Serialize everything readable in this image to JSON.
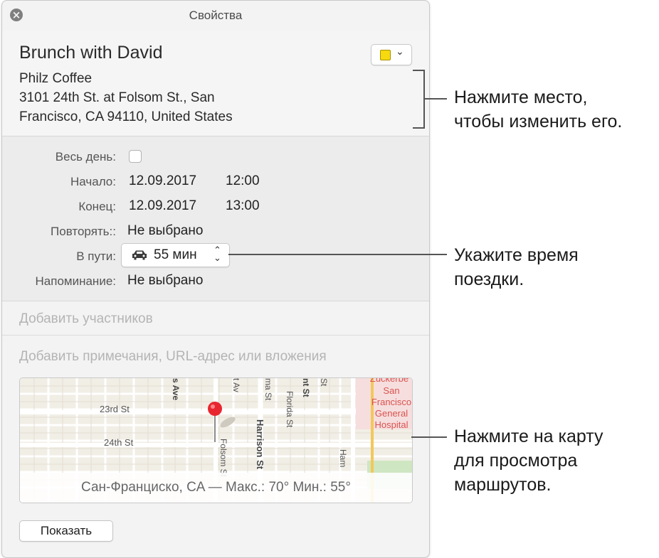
{
  "window": {
    "title": "Свойства"
  },
  "event": {
    "title": "Brunch with David",
    "color": "#f6d90f",
    "location": [
      "Philz Coffee",
      "3101 24th St. at Folsom St., San",
      "Francisco, CA 94110, United States"
    ]
  },
  "details": {
    "all_day_label": "Весь день:",
    "all_day_checked": false,
    "start_label": "Начало:",
    "start_date": "12.09.2017",
    "start_time": "12:00",
    "end_label": "Конец:",
    "end_date": "12.09.2017",
    "end_time": "13:00",
    "repeat_label": "Повторять::",
    "repeat_value": "Не выбрано",
    "travel_label": "В пути:",
    "travel_value": "55 мин",
    "alert_label": "Напоминание:",
    "alert_value": "Не выбрано"
  },
  "invitees_placeholder": "Добавить участников",
  "notes_placeholder": "Добавить примечания, URL-адрес или вложения",
  "map": {
    "streets": [
      "23rd St",
      "24th St",
      "Folsom St",
      "Harrison St",
      "Florida St",
      "s Ave",
      "t Av",
      "ma St",
      "nt St",
      "St",
      "Ham"
    ],
    "hospital_label": [
      "Zuckerbe",
      "San",
      "Francisco",
      "General",
      "Hospital"
    ],
    "weather": "Сан-Франциско, CA — Макс.: 70° Мин.: 55°"
  },
  "show_button": "Показать",
  "callouts": {
    "location": [
      "Нажмите место,",
      "чтобы изменить его."
    ],
    "travel": [
      "Укажите время",
      "поездки."
    ],
    "map": [
      "Нажмите на карту",
      "для просмотра",
      "маршрутов."
    ]
  }
}
